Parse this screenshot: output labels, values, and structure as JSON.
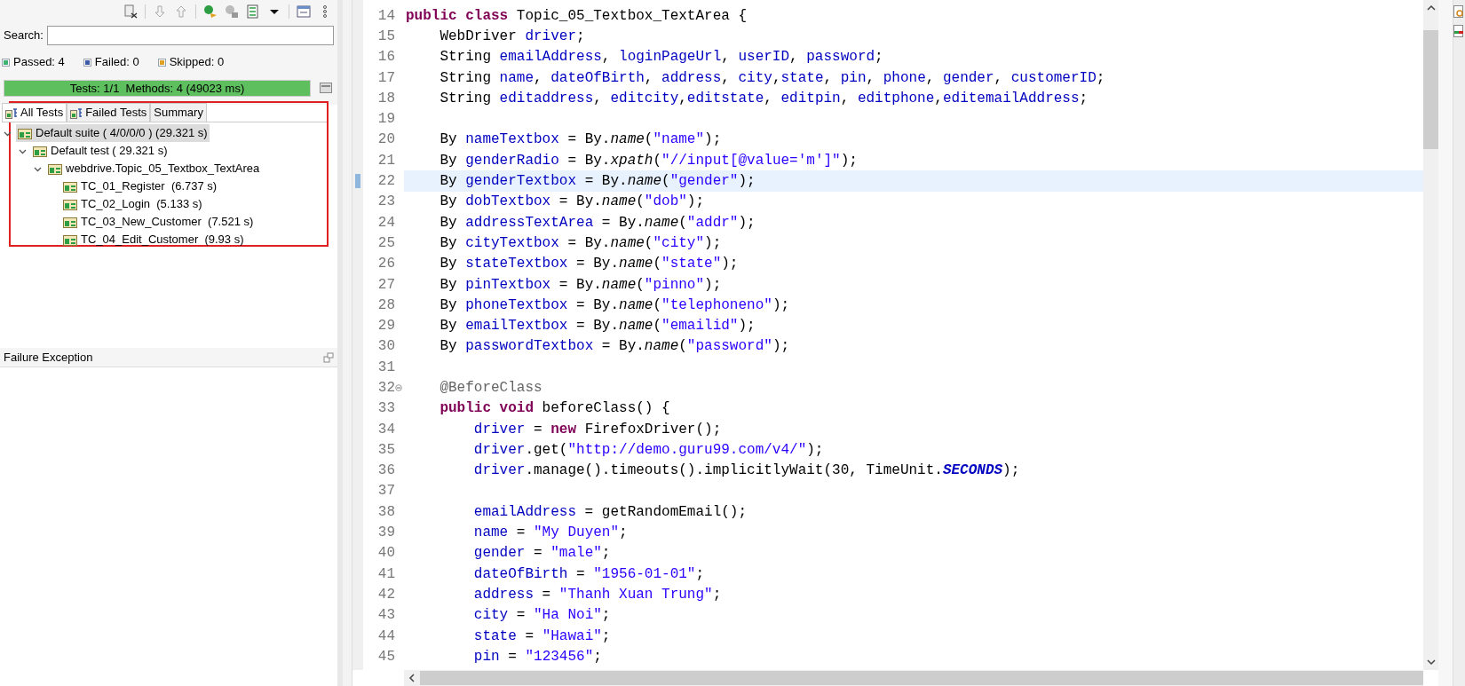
{
  "results_panel": {
    "search": {
      "label": "Search:"
    },
    "counters": [
      {
        "kind": "passed",
        "label": "Passed: 4"
      },
      {
        "kind": "failed",
        "label": "Failed: 0"
      },
      {
        "kind": "skipped",
        "label": "Skipped: 0"
      }
    ],
    "progress": {
      "label": "Tests: 1/1  Methods: 4 (49023 ms)",
      "level": 1
    },
    "tabs": [
      {
        "label": "All Tests",
        "selected": true,
        "icon": true
      },
      {
        "label": "Failed Tests",
        "selected": false,
        "icon": true
      },
      {
        "label": "Summary",
        "selected": false,
        "icon": false
      }
    ],
    "tree": [
      {
        "label": "Default suite ( 4/0/0/0 ) (29.321 s)",
        "selected": true,
        "expanded": true,
        "children": [
          {
            "label": "Default test ( 29.321 s)",
            "selected": false,
            "expanded": true,
            "children": [
              {
                "label": "webdrive.Topic_05_Textbox_TextArea",
                "selected": false,
                "expanded": true,
                "children": [
                  {
                    "label": "TC_01_Register  (6.737 s)",
                    "selected": false
                  },
                  {
                    "label": "TC_02_Login  (5.133 s)",
                    "selected": false
                  },
                  {
                    "label": "TC_03_New_Customer  (7.521 s)",
                    "selected": false
                  },
                  {
                    "label": "TC_04_Edit_Customer  (9.93 s)",
                    "selected": false
                  }
                ]
              }
            ]
          }
        ]
      }
    ],
    "failure_section": {
      "title": "Failure Exception"
    }
  },
  "editor": {
    "lines": [
      {
        "num": "14",
        "kind": "class",
        "current": false,
        "fold": false,
        "tokens": [
          {
            "kind": "keyword",
            "text": "public class"
          },
          {
            "kind": "plain",
            "text": " Topic_05_Textbox_TextArea {"
          }
        ]
      },
      {
        "num": "15",
        "kind": "member",
        "current": false,
        "fold": false,
        "tokens": [
          {
            "kind": "plain",
            "text": "WebDriver "
          },
          {
            "kind": "field",
            "text": "driver"
          },
          {
            "kind": "plain",
            "text": ";"
          }
        ]
      },
      {
        "num": "16",
        "kind": "member",
        "current": false,
        "fold": false,
        "tokens": [
          {
            "kind": "plain",
            "text": "String "
          },
          {
            "kind": "field",
            "text": "emailAddress"
          },
          {
            "kind": "plain",
            "text": ", "
          },
          {
            "kind": "field",
            "text": "loginPageUrl"
          },
          {
            "kind": "plain",
            "text": ", "
          },
          {
            "kind": "field",
            "text": "userID"
          },
          {
            "kind": "plain",
            "text": ", "
          },
          {
            "kind": "field",
            "text": "password"
          },
          {
            "kind": "plain",
            "text": ";"
          }
        ]
      },
      {
        "num": "17",
        "kind": "member",
        "current": false,
        "fold": false,
        "tokens": [
          {
            "kind": "plain",
            "text": "String "
          },
          {
            "kind": "field",
            "text": "name"
          },
          {
            "kind": "plain",
            "text": ", "
          },
          {
            "kind": "field",
            "text": "dateOfBirth"
          },
          {
            "kind": "plain",
            "text": ", "
          },
          {
            "kind": "field",
            "text": "address"
          },
          {
            "kind": "plain",
            "text": ", "
          },
          {
            "kind": "field",
            "text": "city"
          },
          {
            "kind": "plain",
            "text": ","
          },
          {
            "kind": "field",
            "text": "state"
          },
          {
            "kind": "plain",
            "text": ", "
          },
          {
            "kind": "field",
            "text": "pin"
          },
          {
            "kind": "plain",
            "text": ", "
          },
          {
            "kind": "field",
            "text": "phone"
          },
          {
            "kind": "plain",
            "text": ", "
          },
          {
            "kind": "field",
            "text": "gender"
          },
          {
            "kind": "plain",
            "text": ", "
          },
          {
            "kind": "field",
            "text": "customerID"
          },
          {
            "kind": "plain",
            "text": ";"
          }
        ]
      },
      {
        "num": "18",
        "kind": "member",
        "current": false,
        "fold": false,
        "tokens": [
          {
            "kind": "plain",
            "text": "String "
          },
          {
            "kind": "field",
            "text": "editaddress"
          },
          {
            "kind": "plain",
            "text": ", "
          },
          {
            "kind": "field",
            "text": "editcity"
          },
          {
            "kind": "plain",
            "text": ","
          },
          {
            "kind": "field",
            "text": "editstate"
          },
          {
            "kind": "plain",
            "text": ", "
          },
          {
            "kind": "field",
            "text": "editpin"
          },
          {
            "kind": "plain",
            "text": ", "
          },
          {
            "kind": "field",
            "text": "editphone"
          },
          {
            "kind": "plain",
            "text": ","
          },
          {
            "kind": "field",
            "text": "editemailAddress"
          },
          {
            "kind": "plain",
            "text": ";"
          }
        ]
      },
      {
        "num": "19",
        "kind": "member",
        "current": false,
        "fold": false
      },
      {
        "num": "20",
        "kind": "member",
        "current": false,
        "fold": false,
        "tokens": [
          {
            "kind": "plain",
            "text": "By "
          },
          {
            "kind": "field",
            "text": "nameTextbox"
          },
          {
            "kind": "plain",
            "text": " = By."
          },
          {
            "kind": "method",
            "text": "name"
          },
          {
            "kind": "plain",
            "text": "("
          },
          {
            "kind": "string",
            "text": "\"name\""
          },
          {
            "kind": "plain",
            "text": ");"
          }
        ]
      },
      {
        "num": "21",
        "kind": "member",
        "current": false,
        "fold": false,
        "tokens": [
          {
            "kind": "plain",
            "text": "By "
          },
          {
            "kind": "field",
            "text": "genderRadio"
          },
          {
            "kind": "plain",
            "text": " = By."
          },
          {
            "kind": "method",
            "text": "xpath"
          },
          {
            "kind": "plain",
            "text": "("
          },
          {
            "kind": "string",
            "text": "\"//input[@value='m']\""
          },
          {
            "kind": "plain",
            "text": ");"
          }
        ]
      },
      {
        "num": "22",
        "kind": "member",
        "current": true,
        "fold": false,
        "tokens": [
          {
            "kind": "plain",
            "text": "By "
          },
          {
            "kind": "field",
            "text": "genderTextbox"
          },
          {
            "kind": "plain",
            "text": " = By."
          },
          {
            "kind": "method",
            "text": "name"
          },
          {
            "kind": "plain",
            "text": "("
          },
          {
            "kind": "string",
            "text": "\"gender\""
          },
          {
            "kind": "plain",
            "text": ");"
          }
        ]
      },
      {
        "num": "23",
        "kind": "member",
        "current": false,
        "fold": false,
        "tokens": [
          {
            "kind": "plain",
            "text": "By "
          },
          {
            "kind": "field",
            "text": "dobTextbox"
          },
          {
            "kind": "plain",
            "text": " = By."
          },
          {
            "kind": "method",
            "text": "name"
          },
          {
            "kind": "plain",
            "text": "("
          },
          {
            "kind": "string",
            "text": "\"dob\""
          },
          {
            "kind": "plain",
            "text": ");"
          }
        ]
      },
      {
        "num": "24",
        "kind": "member",
        "current": false,
        "fold": false,
        "tokens": [
          {
            "kind": "plain",
            "text": "By "
          },
          {
            "kind": "field",
            "text": "addressTextArea"
          },
          {
            "kind": "plain",
            "text": " = By."
          },
          {
            "kind": "method",
            "text": "name"
          },
          {
            "kind": "plain",
            "text": "("
          },
          {
            "kind": "string",
            "text": "\"addr\""
          },
          {
            "kind": "plain",
            "text": ");"
          }
        ]
      },
      {
        "num": "25",
        "kind": "member",
        "current": false,
        "fold": false,
        "tokens": [
          {
            "kind": "plain",
            "text": "By "
          },
          {
            "kind": "field",
            "text": "cityTextbox"
          },
          {
            "kind": "plain",
            "text": " = By."
          },
          {
            "kind": "method",
            "text": "name"
          },
          {
            "kind": "plain",
            "text": "("
          },
          {
            "kind": "string",
            "text": "\"city\""
          },
          {
            "kind": "plain",
            "text": ");"
          }
        ]
      },
      {
        "num": "26",
        "kind": "member",
        "current": false,
        "fold": false,
        "tokens": [
          {
            "kind": "plain",
            "text": "By "
          },
          {
            "kind": "field",
            "text": "stateTextbox"
          },
          {
            "kind": "plain",
            "text": " = By."
          },
          {
            "kind": "method",
            "text": "name"
          },
          {
            "kind": "plain",
            "text": "("
          },
          {
            "kind": "string",
            "text": "\"state\""
          },
          {
            "kind": "plain",
            "text": ");"
          }
        ]
      },
      {
        "num": "27",
        "kind": "member",
        "current": false,
        "fold": false,
        "tokens": [
          {
            "kind": "plain",
            "text": "By "
          },
          {
            "kind": "field",
            "text": "pinTextbox"
          },
          {
            "kind": "plain",
            "text": " = By."
          },
          {
            "kind": "method",
            "text": "name"
          },
          {
            "kind": "plain",
            "text": "("
          },
          {
            "kind": "string",
            "text": "\"pinno\""
          },
          {
            "kind": "plain",
            "text": ");"
          }
        ]
      },
      {
        "num": "28",
        "kind": "member",
        "current": false,
        "fold": false,
        "tokens": [
          {
            "kind": "plain",
            "text": "By "
          },
          {
            "kind": "field",
            "text": "phoneTextbox"
          },
          {
            "kind": "plain",
            "text": " = By."
          },
          {
            "kind": "method",
            "text": "name"
          },
          {
            "kind": "plain",
            "text": "("
          },
          {
            "kind": "string",
            "text": "\"telephoneno\""
          },
          {
            "kind": "plain",
            "text": ");"
          }
        ]
      },
      {
        "num": "29",
        "kind": "member",
        "current": false,
        "fold": false,
        "tokens": [
          {
            "kind": "plain",
            "text": "By "
          },
          {
            "kind": "field",
            "text": "emailTextbox"
          },
          {
            "kind": "plain",
            "text": " = By."
          },
          {
            "kind": "method",
            "text": "name"
          },
          {
            "kind": "plain",
            "text": "("
          },
          {
            "kind": "string",
            "text": "\"emailid\""
          },
          {
            "kind": "plain",
            "text": ");"
          }
        ]
      },
      {
        "num": "30",
        "kind": "member",
        "current": false,
        "fold": false,
        "tokens": [
          {
            "kind": "plain",
            "text": "By "
          },
          {
            "kind": "field",
            "text": "passwordTextbox"
          },
          {
            "kind": "plain",
            "text": " = By."
          },
          {
            "kind": "method",
            "text": "name"
          },
          {
            "kind": "plain",
            "text": "("
          },
          {
            "kind": "string",
            "text": "\"password\""
          },
          {
            "kind": "plain",
            "text": ");"
          }
        ]
      },
      {
        "num": "31",
        "kind": "member",
        "current": false,
        "fold": false
      },
      {
        "num": "32",
        "kind": "member",
        "current": false,
        "fold": true,
        "tokens": [
          {
            "kind": "annotation",
            "text": "@BeforeClass"
          }
        ]
      },
      {
        "num": "33",
        "kind": "member",
        "current": false,
        "fold": false,
        "tokens": [
          {
            "kind": "keyword",
            "text": "public void"
          },
          {
            "kind": "plain",
            "text": " beforeClass() {"
          }
        ]
      },
      {
        "num": "34",
        "kind": "body",
        "current": false,
        "fold": false,
        "tokens": [
          {
            "kind": "field",
            "text": "driver"
          },
          {
            "kind": "plain",
            "text": " = "
          },
          {
            "kind": "keyword",
            "text": "new"
          },
          {
            "kind": "plain",
            "text": " FirefoxDriver();"
          }
        ]
      },
      {
        "num": "35",
        "kind": "body",
        "current": false,
        "fold": false,
        "tokens": [
          {
            "kind": "field",
            "text": "driver"
          },
          {
            "kind": "plain",
            "text": ".get("
          },
          {
            "kind": "string",
            "text": "\"http://demo.guru99.com/v4/\""
          },
          {
            "kind": "plain",
            "text": ");"
          }
        ]
      },
      {
        "num": "36",
        "kind": "body",
        "current": false,
        "fold": false,
        "tokens": [
          {
            "kind": "field",
            "text": "driver"
          },
          {
            "kind": "plain",
            "text": ".manage().timeouts().implicitlyWait(30, TimeUnit."
          },
          {
            "kind": "constant",
            "text": "SECONDS"
          },
          {
            "kind": "plain",
            "text": ");"
          }
        ]
      },
      {
        "num": "37",
        "kind": "body",
        "current": false,
        "fold": false
      },
      {
        "num": "38",
        "kind": "body",
        "current": false,
        "fold": false,
        "tokens": [
          {
            "kind": "field",
            "text": "emailAddress"
          },
          {
            "kind": "plain",
            "text": " = getRandomEmail();"
          }
        ]
      },
      {
        "num": "39",
        "kind": "body",
        "current": false,
        "fold": false,
        "tokens": [
          {
            "kind": "field",
            "text": "name"
          },
          {
            "kind": "plain",
            "text": " = "
          },
          {
            "kind": "string",
            "text": "\"My Duyen\""
          },
          {
            "kind": "plain",
            "text": ";"
          }
        ]
      },
      {
        "num": "40",
        "kind": "body",
        "current": false,
        "fold": false,
        "tokens": [
          {
            "kind": "field",
            "text": "gender"
          },
          {
            "kind": "plain",
            "text": " = "
          },
          {
            "kind": "string",
            "text": "\"male\""
          },
          {
            "kind": "plain",
            "text": ";"
          }
        ]
      },
      {
        "num": "41",
        "kind": "body",
        "current": false,
        "fold": false,
        "tokens": [
          {
            "kind": "field",
            "text": "dateOfBirth"
          },
          {
            "kind": "plain",
            "text": " = "
          },
          {
            "kind": "string",
            "text": "\"1956-01-01\""
          },
          {
            "kind": "plain",
            "text": ";"
          }
        ]
      },
      {
        "num": "42",
        "kind": "body",
        "current": false,
        "fold": false,
        "tokens": [
          {
            "kind": "field",
            "text": "address"
          },
          {
            "kind": "plain",
            "text": " = "
          },
          {
            "kind": "string",
            "text": "\"Thanh Xuan Trung\""
          },
          {
            "kind": "plain",
            "text": ";"
          }
        ]
      },
      {
        "num": "43",
        "kind": "body",
        "current": false,
        "fold": false,
        "tokens": [
          {
            "kind": "field",
            "text": "city"
          },
          {
            "kind": "plain",
            "text": " = "
          },
          {
            "kind": "string",
            "text": "\"Ha Noi\""
          },
          {
            "kind": "plain",
            "text": ";"
          }
        ]
      },
      {
        "num": "44",
        "kind": "body",
        "current": false,
        "fold": false,
        "tokens": [
          {
            "kind": "field",
            "text": "state"
          },
          {
            "kind": "plain",
            "text": " = "
          },
          {
            "kind": "string",
            "text": "\"Hawai\""
          },
          {
            "kind": "plain",
            "text": ";"
          }
        ]
      },
      {
        "num": "45",
        "kind": "body",
        "current": false,
        "fold": false,
        "tokens": [
          {
            "kind": "field",
            "text": "pin"
          },
          {
            "kind": "plain",
            "text": " = "
          },
          {
            "kind": "string",
            "text": "\"123456\""
          },
          {
            "kind": "plain",
            "text": ";"
          }
        ]
      }
    ]
  }
}
